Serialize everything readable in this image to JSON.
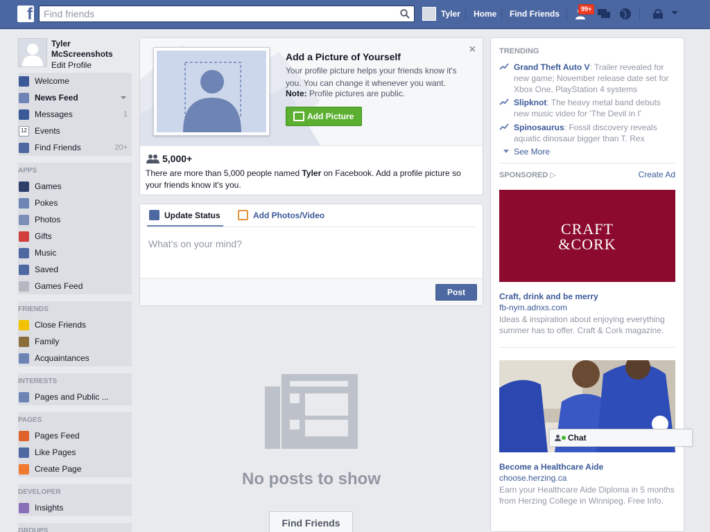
{
  "topbar": {
    "search_placeholder": "Find friends",
    "user_name": "Tyler",
    "home": "Home",
    "find_friends": "Find Friends",
    "notif_count": "99+"
  },
  "profile": {
    "name": "Tyler McScreenshots",
    "edit": "Edit Profile"
  },
  "sidebar": {
    "main": [
      {
        "label": "Welcome",
        "icon": "facebook-icon"
      },
      {
        "label": "News Feed",
        "icon": "news-feed-icon"
      },
      {
        "label": "Messages",
        "icon": "messages-icon",
        "count": "1"
      },
      {
        "label": "Events",
        "icon": "calendar-icon",
        "badge": "12"
      },
      {
        "label": "Find Friends",
        "icon": "find-friends-icon",
        "count": "20+"
      }
    ],
    "apps_title": "APPS",
    "apps": [
      {
        "label": "Games",
        "icon": "games-icon"
      },
      {
        "label": "Pokes",
        "icon": "pokes-icon"
      },
      {
        "label": "Photos",
        "icon": "photos-icon"
      },
      {
        "label": "Gifts",
        "icon": "gift-icon"
      },
      {
        "label": "Music",
        "icon": "music-icon"
      },
      {
        "label": "Saved",
        "icon": "bookmark-icon"
      },
      {
        "label": "Games Feed",
        "icon": "gamepad-icon"
      }
    ],
    "friends_title": "FRIENDS",
    "friends": [
      {
        "label": "Close Friends",
        "icon": "star-icon"
      },
      {
        "label": "Family",
        "icon": "house-icon"
      },
      {
        "label": "Acquaintances",
        "icon": "acquaintances-icon"
      }
    ],
    "interests_title": "INTERESTS",
    "interests": [
      {
        "label": "Pages and Public ...",
        "icon": "pages-list-icon"
      }
    ],
    "pages_title": "PAGES",
    "pages": [
      {
        "label": "Pages Feed",
        "icon": "pages-feed-icon"
      },
      {
        "label": "Like Pages",
        "icon": "thumbs-up-icon"
      },
      {
        "label": "Create Page",
        "icon": "plus-icon"
      }
    ],
    "developer_title": "DEVELOPER",
    "developer": [
      {
        "label": "Insights",
        "icon": "insights-icon"
      }
    ],
    "groups_title": "GROUPS"
  },
  "add_picture": {
    "title": "Add a Picture of Yourself",
    "desc": "Your profile picture helps your friends know it's you. You can change it whenever you want.",
    "note_label": "Note:",
    "note_text": " Profile pictures are public.",
    "button": "Add Picture",
    "close": "×",
    "people_count": "5,000+",
    "people_text_a": "There are more than 5,000 people named ",
    "people_text_name": "Tyler",
    "people_text_b": " on Facebook. Add a profile picture so your friends know it's you."
  },
  "composer": {
    "tab_status": "Update Status",
    "tab_photos": "Add Photos/Video",
    "placeholder": "What's on your mind?",
    "post": "Post"
  },
  "feed": {
    "empty": "No posts to show",
    "find_friends": "Find Friends"
  },
  "trending": {
    "title": "TRENDING",
    "items": [
      {
        "topic": "Grand Theft Auto V",
        "text": ": Trailer revealed for new game; November release date set for Xbox One, PlayStation 4 systems"
      },
      {
        "topic": "Slipknot",
        "text": ": The heavy metal band debuts new music video for 'The Devil in I'"
      },
      {
        "topic": "Spinosaurus",
        "text": ": Fossil discovery reveals aquatic dinosaur bigger than T. Rex"
      }
    ],
    "see_more": "See More"
  },
  "sponsored": {
    "title": "SPONSORED",
    "create_ad": "Create Ad",
    "ads": [
      {
        "logo_line1": "CRAFT",
        "logo_line2": "&CORK",
        "title": "Craft, drink and be merry",
        "url": "fb-nym.adnxs.com",
        "desc": "Ideas & inspiration about enjoying everything summer has to offer. Craft & Cork magazine."
      },
      {
        "title": "Become a Healthcare Aide",
        "url": "choose.herzing.ca",
        "desc": "Earn your Healthcare Aide Diploma in 5 months from Herzing College in Winnipeg. Free Info."
      }
    ]
  },
  "chat": {
    "label": "Chat"
  },
  "colors": {
    "topbar": "#4b67a1",
    "link": "#3b5998",
    "green": "#5cb031",
    "ad_bg": "#8b0a2e"
  }
}
